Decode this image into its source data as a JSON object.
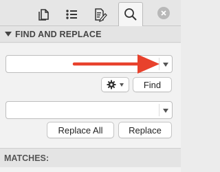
{
  "toolbar": {
    "tabs": [
      {
        "icon": "document-pages-icon",
        "active": false
      },
      {
        "icon": "list-icon",
        "active": false
      },
      {
        "icon": "edit-document-icon",
        "active": false
      },
      {
        "icon": "search-icon",
        "active": true
      }
    ],
    "close_icon": "close-circle-icon"
  },
  "find_replace": {
    "section_title": "FIND AND REPLACE",
    "find_field": {
      "value": "",
      "placeholder": ""
    },
    "replace_field": {
      "value": "",
      "placeholder": ""
    },
    "options_icon": "gear-icon",
    "find_label": "Find",
    "replace_all_label": "Replace All",
    "replace_label": "Replace"
  },
  "matches": {
    "section_title": "MATCHES:"
  },
  "colors": {
    "annotation_arrow": "#e8412c"
  }
}
